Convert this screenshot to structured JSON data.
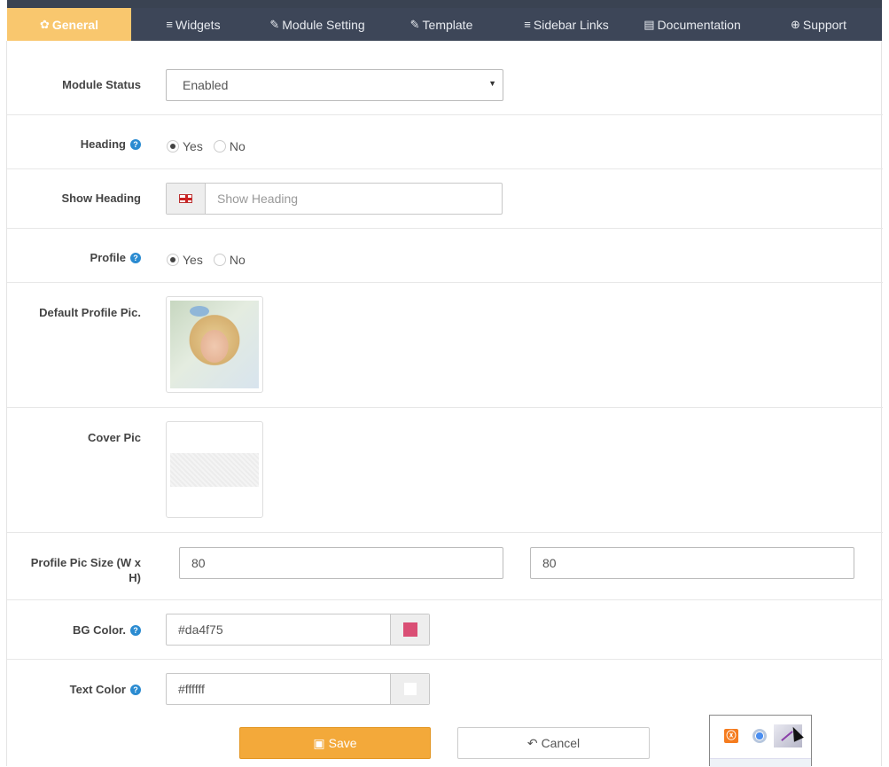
{
  "nav": {
    "tabs": [
      {
        "label": "General",
        "icon": "gear-icon",
        "glyph": "✿"
      },
      {
        "label": "Widgets",
        "icon": "list-icon",
        "glyph": "≡"
      },
      {
        "label": "Module Setting",
        "icon": "pencil-icon",
        "glyph": "✎"
      },
      {
        "label": "Template",
        "icon": "pencil-icon",
        "glyph": "✎"
      },
      {
        "label": "Sidebar Links",
        "icon": "list-icon",
        "glyph": "≡"
      },
      {
        "label": "Documentation",
        "icon": "document-icon",
        "glyph": "▤"
      },
      {
        "label": "Support",
        "icon": "lifebuoy-icon",
        "glyph": "⊕"
      }
    ],
    "active_index": 0
  },
  "form": {
    "module_status": {
      "label": "Module Status",
      "value": "Enabled"
    },
    "heading": {
      "label": "Heading",
      "yes": "Yes",
      "no": "No",
      "selected": "Yes"
    },
    "show_heading": {
      "label": "Show Heading",
      "placeholder": "Show Heading"
    },
    "profile": {
      "label": "Profile",
      "yes": "Yes",
      "no": "No",
      "selected": "Yes"
    },
    "default_profile_pic": {
      "label": "Default Profile Pic."
    },
    "cover_pic": {
      "label": "Cover Pic"
    },
    "profile_pic_size": {
      "label": "Profile Pic Size (W x H)",
      "width": "80",
      "height": "80"
    },
    "bg_color": {
      "label": "BG Color.",
      "value": "#da4f75",
      "swatch": "#da4f75"
    },
    "text_color": {
      "label": "Text Color",
      "value": "#ffffff",
      "swatch": "#ffffff"
    },
    "help_glyph": "?"
  },
  "actions": {
    "save_label": "Save",
    "cancel_label": "Cancel"
  },
  "tray": {
    "xampp_glyph": "ⓧ",
    "icons": [
      "xampp-icon",
      "chrome-icon",
      "pen-tablet-icon"
    ]
  },
  "colors": {
    "nav_bg": "#3d4658",
    "active_tab": "#f9c76e",
    "save_button": "#f3a93a",
    "help_icon": "#2a8bd1"
  }
}
